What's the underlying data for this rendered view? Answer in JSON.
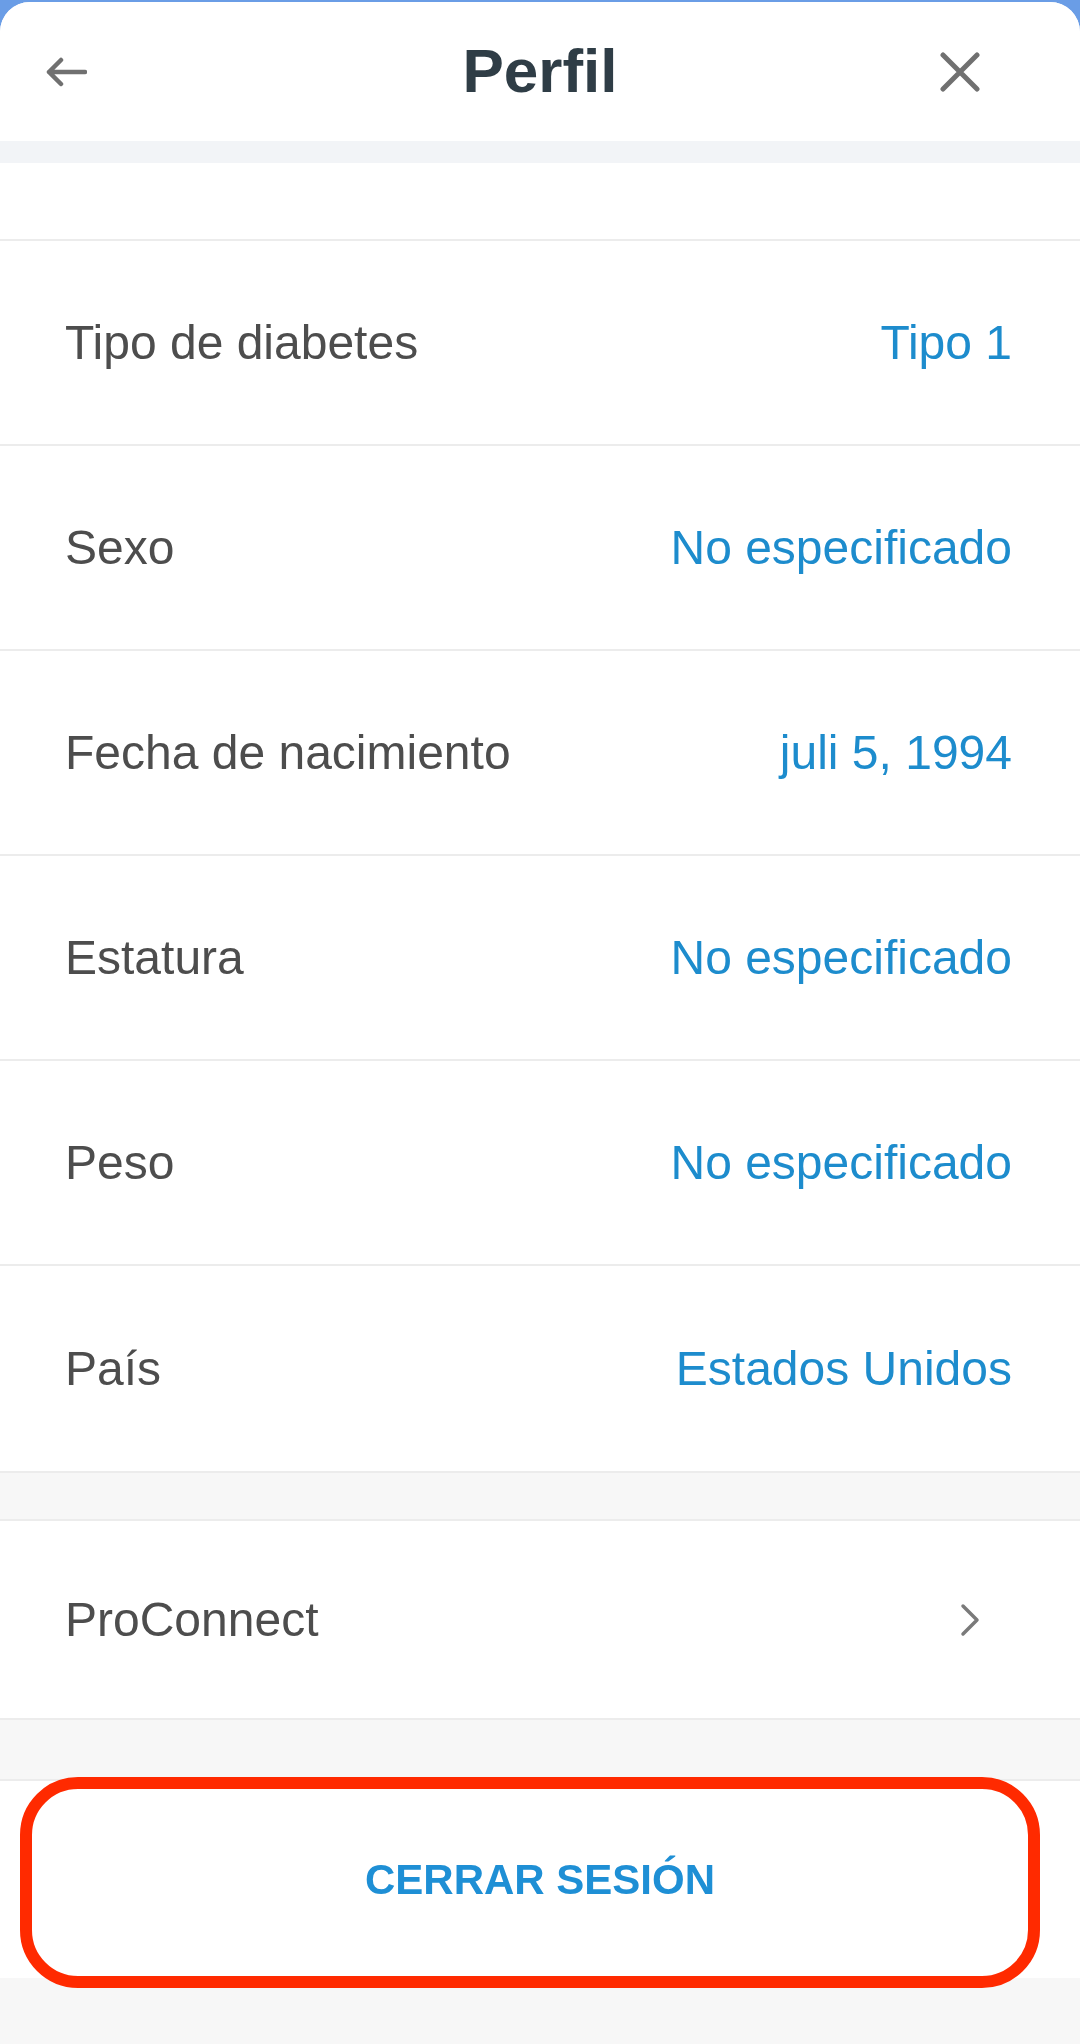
{
  "header": {
    "title": "Perfil"
  },
  "fields": [
    {
      "label": "Tipo de diabetes",
      "value": "Tipo 1"
    },
    {
      "label": "Sexo",
      "value": "No especificado"
    },
    {
      "label": "Fecha de nacimiento",
      "value": "juli 5, 1994"
    },
    {
      "label": "Estatura",
      "value": "No especificado"
    },
    {
      "label": "Peso",
      "value": "No especificado"
    },
    {
      "label": "País",
      "value": "Estados Unidos"
    }
  ],
  "links": [
    {
      "label": "ProConnect"
    }
  ],
  "logout": {
    "label": "CERRAR SESIÓN",
    "highlighted": true
  }
}
